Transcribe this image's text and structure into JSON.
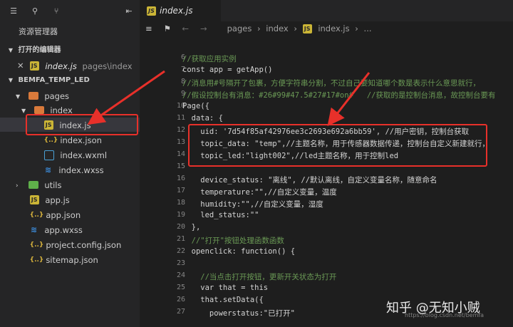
{
  "sidebar": {
    "title": "资源管理器",
    "open_editors_label": "打开的编辑器",
    "open_editor": {
      "name": "index.js",
      "path": "pages\\index"
    },
    "project_label": "BEMFA_TEMP_LED",
    "tree": [
      {
        "label": "pages",
        "type": "folder"
      },
      {
        "label": "index",
        "type": "folder-open"
      },
      {
        "label": "index.js",
        "type": "js"
      },
      {
        "label": "index.json",
        "type": "json"
      },
      {
        "label": "index.wxml",
        "type": "wxml"
      },
      {
        "label": "index.wxss",
        "type": "wxss"
      },
      {
        "label": "utils",
        "type": "folder-green"
      },
      {
        "label": "app.js",
        "type": "js"
      },
      {
        "label": "app.json",
        "type": "json"
      },
      {
        "label": "app.wxss",
        "type": "wxss"
      },
      {
        "label": "project.config.json",
        "type": "json"
      },
      {
        "label": "sitemap.json",
        "type": "json"
      }
    ]
  },
  "editor": {
    "tab_label": "index.js",
    "breadcrumb": {
      "b1": "pages",
      "b2": "index",
      "b3": "index.js",
      "b4": "..."
    },
    "lines": [
      {
        "n": "6",
        "t": "//获取应用实例"
      },
      {
        "n": "7",
        "t": "const app = getApp()"
      },
      {
        "n": "8",
        "t": "//消息用#号隔开了包裹，方便字符串分割，不过自己要知道哪个数是表示什么意思就行，"
      },
      {
        "n": "9",
        "t": "//假设控制台有消息：#26#99#47.5#27#17#on#   //获取的是控制台消息，故控制台要有"
      },
      {
        "n": "10",
        "t": "Page({"
      },
      {
        "n": "11",
        "t": "  data: {"
      },
      {
        "n": "12",
        "t": "    uid: '7d54f85af42976ee3c2693e692a6bb59', //用户密钥，控制台获取"
      },
      {
        "n": "13",
        "t": "    topic_data: \"temp\",//主题名称，用于传感器数据传递，控制台自定义新建就行，"
      },
      {
        "n": "14",
        "t": "    topic_led:\"light002\",//led主题名称，用于控制led"
      },
      {
        "n": "15",
        "t": ""
      },
      {
        "n": "16",
        "t": "    device_status: \"离线\", //默认离线，自定义变量名称，随意命名"
      },
      {
        "n": "17",
        "t": "    temperature:\"\",//自定义变量，温度"
      },
      {
        "n": "18",
        "t": "    humidity:\"\",//自定义变量，湿度"
      },
      {
        "n": "19",
        "t": "    led_status:\"\""
      },
      {
        "n": "20",
        "t": "  },"
      },
      {
        "n": "21",
        "t": "  //\"打开\"按钮处理函数函数"
      },
      {
        "n": "22",
        "t": "  openclick: function() {"
      },
      {
        "n": "23",
        "t": ""
      },
      {
        "n": "24",
        "t": "    //当点击打开按钮，更新开关状态为打开"
      },
      {
        "n": "25",
        "t": "    var that = this"
      },
      {
        "n": "26",
        "t": "    that.setData({"
      },
      {
        "n": "27",
        "t": "      powerstatus:\"已打开\""
      }
    ]
  },
  "watermark": {
    "text1": "知乎 @无知小贼",
    "text2": "https://blog.csdn.net/bemfa"
  },
  "colors": {
    "accent_red": "#e8302a",
    "comment": "#6a9955",
    "string": "#ce9178",
    "keyword": "#c586c0"
  }
}
